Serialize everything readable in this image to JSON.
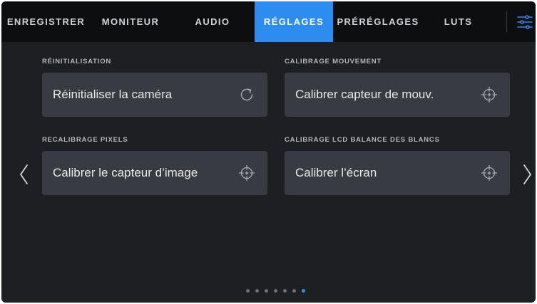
{
  "tabs": [
    {
      "label": "ENREGISTRER",
      "active": false
    },
    {
      "label": "MONITEUR",
      "active": false
    },
    {
      "label": "AUDIO",
      "active": false
    },
    {
      "label": "RÉGLAGES",
      "active": true
    },
    {
      "label": "PRÉRÉGLAGES",
      "active": false
    },
    {
      "label": "LUTS",
      "active": false
    }
  ],
  "menu_icon": "sliders-icon",
  "sections": [
    {
      "label": "RÉINITIALISATION",
      "button_label": "Réinitialiser la caméra",
      "icon": "refresh-icon"
    },
    {
      "label": "CALIBRAGE MOUVEMENT",
      "button_label": "Calibrer capteur de mouv.",
      "icon": "crosshair-icon"
    },
    {
      "label": "RECALIBRAGE PIXELS",
      "button_label": "Calibrer le capteur d’image",
      "icon": "crosshair-icon"
    },
    {
      "label": "CALIBRAGE LCD BALANCE DES BLANCS",
      "button_label": "Calibrer l’écran",
      "icon": "crosshair-icon"
    }
  ],
  "navigation": {
    "prev_icon": "chevron-left-icon",
    "next_icon": "chevron-right-icon"
  },
  "pagination": {
    "total_pages": 7,
    "current_page": 7
  },
  "colors": {
    "accent": "#2d8cf0",
    "background": "#1d1f23",
    "tabbar": "#0d0e10",
    "card": "#383c42"
  }
}
